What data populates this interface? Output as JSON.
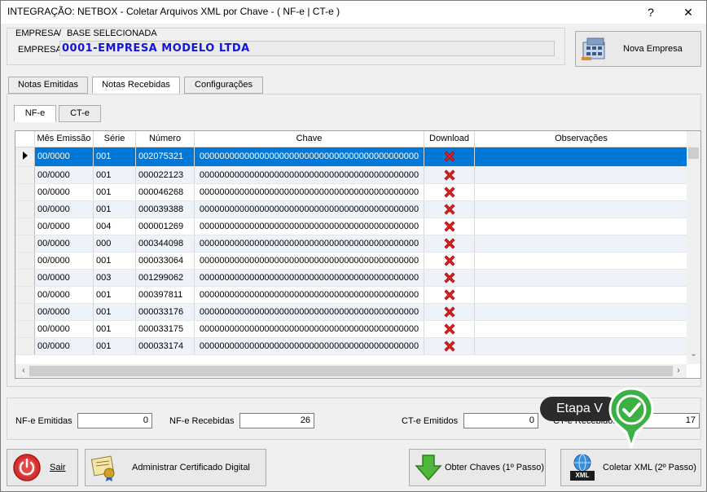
{
  "window": {
    "title": "INTEGRAÇÃO: NETBOX - Coletar Arquivos XML por Chave - ( NF-e | CT-e )",
    "help_label": "?",
    "close_label": "✕"
  },
  "empresa": {
    "header_left": "EMPRESA",
    "header_sep": "/",
    "header_right": "BASE SELECIONADA",
    "label": "EMPRESA",
    "value": "0001-EMPRESA MODELO LTDA",
    "nova_empresa_label": "Nova Empresa"
  },
  "tabs": [
    {
      "label": "Notas Emitidas"
    },
    {
      "label": "Notas Recebidas"
    },
    {
      "label": "Configurações"
    }
  ],
  "subtabs": [
    {
      "label": "NF-e"
    },
    {
      "label": "CT-e"
    }
  ],
  "grid": {
    "columns": [
      "Mês Emissão",
      "Série",
      "Número",
      "Chave",
      "Download",
      "Observações"
    ],
    "rows": [
      {
        "mes": "00/0000",
        "serie": "001",
        "numero": "002075321",
        "chave": "00000000000000000000000000000000000000000000",
        "obs": ""
      },
      {
        "mes": "00/0000",
        "serie": "001",
        "numero": "000022123",
        "chave": "00000000000000000000000000000000000000000000",
        "obs": ""
      },
      {
        "mes": "00/0000",
        "serie": "001",
        "numero": "000046268",
        "chave": "00000000000000000000000000000000000000000000",
        "obs": ""
      },
      {
        "mes": "00/0000",
        "serie": "001",
        "numero": "000039388",
        "chave": "00000000000000000000000000000000000000000000",
        "obs": ""
      },
      {
        "mes": "00/0000",
        "serie": "004",
        "numero": "000001269",
        "chave": "00000000000000000000000000000000000000000000",
        "obs": ""
      },
      {
        "mes": "00/0000",
        "serie": "000",
        "numero": "000344098",
        "chave": "00000000000000000000000000000000000000000000",
        "obs": ""
      },
      {
        "mes": "00/0000",
        "serie": "001",
        "numero": "000033064",
        "chave": "00000000000000000000000000000000000000000000",
        "obs": ""
      },
      {
        "mes": "00/0000",
        "serie": "003",
        "numero": "001299062",
        "chave": "00000000000000000000000000000000000000000000",
        "obs": ""
      },
      {
        "mes": "00/0000",
        "serie": "001",
        "numero": "000397811",
        "chave": "00000000000000000000000000000000000000000000",
        "obs": ""
      },
      {
        "mes": "00/0000",
        "serie": "001",
        "numero": "000033176",
        "chave": "00000000000000000000000000000000000000000000",
        "obs": ""
      },
      {
        "mes": "00/0000",
        "serie": "001",
        "numero": "000033175",
        "chave": "00000000000000000000000000000000000000000000",
        "obs": ""
      },
      {
        "mes": "00/0000",
        "serie": "001",
        "numero": "000033174",
        "chave": "00000000000000000000000000000000000000000000",
        "obs": ""
      }
    ]
  },
  "totals": {
    "nfe_emitidas_label": "NF-e Emitidas",
    "nfe_emitidas_value": "0",
    "nfe_recebidas_label": "NF-e Recebidas",
    "nfe_recebidas_value": "26",
    "cte_emitidos_label": "CT-e Emitidos",
    "cte_emitidos_value": "0",
    "cte_recebidos_label": "CT-e Recebidos",
    "cte_recebidos_value": "17"
  },
  "callout": {
    "text": "Etapa V"
  },
  "actions": {
    "sair_label": "Sair",
    "certificado_label": "Administrar Certificado Digital",
    "obter_label": "Obter Chaves (1º Passo)",
    "coletar_label": "Coletar XML (2º Passo)",
    "xml_badge": "XML"
  },
  "colors": {
    "selection": "#0078d7",
    "empresa_text": "#1515d8",
    "callout_green": "#3cb043"
  }
}
